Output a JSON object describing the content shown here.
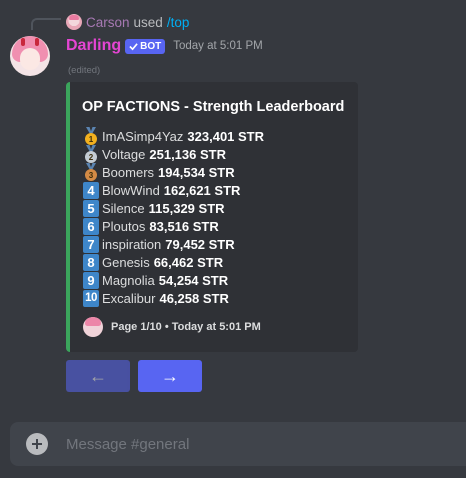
{
  "reply": {
    "user": "Carson",
    "used_text": "used",
    "command": "/top"
  },
  "message": {
    "username": "Darling",
    "bot_badge": "BOT",
    "bot_check_icon": "checkmark-icon",
    "timestamp": "Today at 5:01 PM",
    "edited": "(edited)"
  },
  "embed": {
    "accent_color": "#3ba55c",
    "title": "OP FACTIONS - Strength Leaderboard",
    "rows": [
      {
        "rank": "1",
        "rank_style": "gold-medal",
        "name": "ImASimp4Yaz",
        "value": "323,401 STR"
      },
      {
        "rank": "2",
        "rank_style": "silver-medal",
        "name": "Voltage",
        "value": "251,136 STR"
      },
      {
        "rank": "3",
        "rank_style": "bronze-medal",
        "name": "Boomers",
        "value": "194,534 STR"
      },
      {
        "rank": "4",
        "rank_style": "keycap",
        "name": "BlowWind",
        "value": "162,621 STR"
      },
      {
        "rank": "5",
        "rank_style": "keycap",
        "name": "Silence",
        "value": "115,329 STR"
      },
      {
        "rank": "6",
        "rank_style": "keycap",
        "name": "Ploutos",
        "value": "83,516 STR"
      },
      {
        "rank": "7",
        "rank_style": "keycap",
        "name": "inspiration",
        "value": "79,452 STR"
      },
      {
        "rank": "8",
        "rank_style": "keycap",
        "name": "Genesis",
        "value": "66,462 STR"
      },
      {
        "rank": "9",
        "rank_style": "keycap",
        "name": "Magnolia",
        "value": "54,254 STR"
      },
      {
        "rank": "10",
        "rank_style": "keycap",
        "name": "Excalibur",
        "value": "46,258 STR"
      }
    ],
    "footer": "Page 1/10 • Today at 5:01 PM"
  },
  "buttons": {
    "prev": "←",
    "next": "→"
  },
  "composer": {
    "placeholder": "Message #general"
  },
  "colors": {
    "background": "#36393f",
    "embed_bg": "#2f3136",
    "username": "#e545d3",
    "blurple": "#5865f2",
    "keycap": "#3e86c9",
    "gold": "#f2b01e",
    "silver": "#c4cbd2",
    "bronze": "#d38a45"
  }
}
